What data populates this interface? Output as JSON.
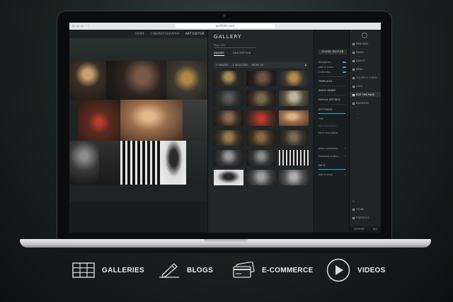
{
  "browser": {
    "url": "portfolio.com"
  },
  "site": {
    "nav": [
      "HOME",
      "CINEMATOGRAPHY",
      "ART EDITOR"
    ]
  },
  "gallery": {
    "title": "GALLERY",
    "search_placeholder": "Page title",
    "tabs": [
      "IMAGES",
      "DESCRIPTION"
    ],
    "toolbar": {
      "add": "+ IMAGES",
      "selected": "1 SELECTED",
      "move": "MOVE TO"
    }
  },
  "settings": {
    "close_editor": "CLOSE EDITOR",
    "rows_top": [
      "Navigation",
      "Add to menu",
      "Fullscreen"
    ],
    "links": [
      "TEMPLATES",
      "IMAGE VIEWER",
      "DISPLAY SETTINGS"
    ],
    "section_settings": "SETTINGS",
    "fields": [
      "Title",
      "Add description",
      "More description"
    ],
    "rows_mid": [
      "Allow comments",
      "Password protect"
    ],
    "section_info": "INFO",
    "rows_bottom": [
      "Add to store"
    ]
  },
  "menu": {
    "items": [
      "NEW PAGE",
      "PAGES",
      "LAYOUT",
      "MENU",
      "COLORS & FONTS",
      "LOGO",
      "EDIT THIS PAGE",
      "FAVORITES"
    ],
    "active": "EDIT THIS PAGE",
    "bottom_items": [
      "STORE",
      "STATISTICS"
    ],
    "footer": [
      "SUPPORT",
      "FAQ"
    ]
  },
  "features": [
    {
      "icon": "grid-icon",
      "label": "GALLERIES"
    },
    {
      "icon": "pen-icon",
      "label": "BLOGS"
    },
    {
      "icon": "cards-icon",
      "label": "E-COMMERCE"
    },
    {
      "icon": "play-icon",
      "label": "VIDEOS"
    }
  ],
  "colors": {
    "accent": "#30b0c8",
    "background": "#1d2624",
    "panel": "#222628"
  }
}
